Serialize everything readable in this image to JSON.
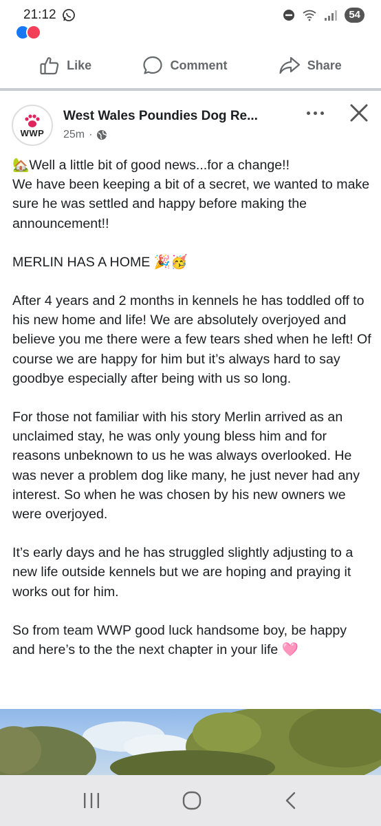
{
  "status_bar": {
    "time": "21:12",
    "battery": "54"
  },
  "actions": {
    "like": "Like",
    "comment": "Comment",
    "share": "Share"
  },
  "post": {
    "page_name": "West Wales Poundies Dog Re...",
    "avatar_text": "WWP",
    "time_ago": "25m",
    "meta_separator": "·",
    "paragraphs": [
      "🏡Well a little bit of good news...for a change!!\nWe have been keeping a bit of a secret, we wanted to make sure he was settled and happy before making the announcement!!",
      "MERLIN HAS A HOME 🎉🥳",
      "After 4 years and 2 months in kennels he has toddled off to his new home and life! We are absolutely overjoyed and believe you me there were a few tears shed when he left! Of course we are happy for him but it’s always hard to say goodbye especially after being with us so long.",
      "For those not familiar with his story Merlin arrived as an unclaimed stay, he was only young bless him and for reasons unbeknown to us he was always overlooked. He was never a problem dog like many, he just never had any interest. So when he was chosen by his new owners we were overjoyed.",
      "It’s early days and he has struggled slightly adjusting to a new life outside kennels but we are hoping and praying it works out for him.",
      "So from team WWP good luck handsome boy, be happy and here’s to the the next chapter in your life 🩷"
    ]
  },
  "colors": {
    "like_reaction": "#1877f2",
    "love_reaction": "#f33e58",
    "secondary_text": "#65676b",
    "divider": "#c9ccd1"
  },
  "icons": {
    "whatsapp": "whatsapp-icon",
    "dnd": "do-not-disturb-icon",
    "wifi": "wifi-icon",
    "signal": "signal-icon",
    "like": "thumbs-up-icon",
    "comment": "speech-bubble-icon",
    "share": "share-arrow-icon",
    "globe": "globe-icon",
    "more": "more-dots-icon",
    "close": "close-icon",
    "recents": "recent-apps-icon",
    "home": "home-icon",
    "back": "back-icon"
  }
}
